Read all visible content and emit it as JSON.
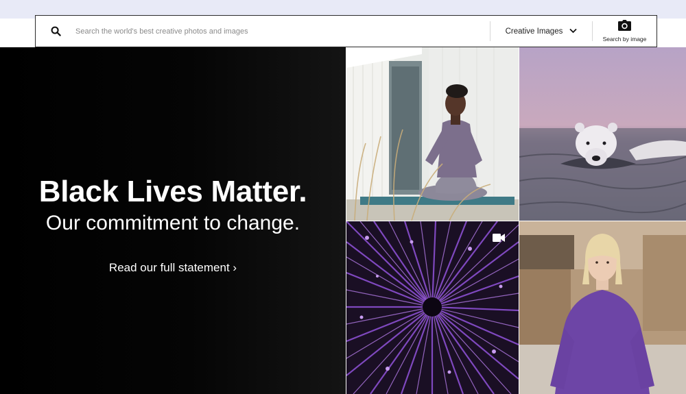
{
  "search": {
    "placeholder": "Search the world's best creative photos and images",
    "type_selected": "Creative Images",
    "image_search_label": "Search by image"
  },
  "hero": {
    "title": "Black Lives Matter.",
    "subtitle": "Our commitment to change.",
    "link_label": "Read our full statement ›"
  },
  "icons": {
    "search": "search-icon",
    "dropdown": "chevron-down-icon",
    "camera": "camera-icon",
    "video": "video-camera-icon"
  },
  "colors": {
    "top_strip": "#e8eaf7",
    "hero_bg": "#000000",
    "text_light": "#ffffff",
    "accent_purple": "#6a3fa8"
  }
}
